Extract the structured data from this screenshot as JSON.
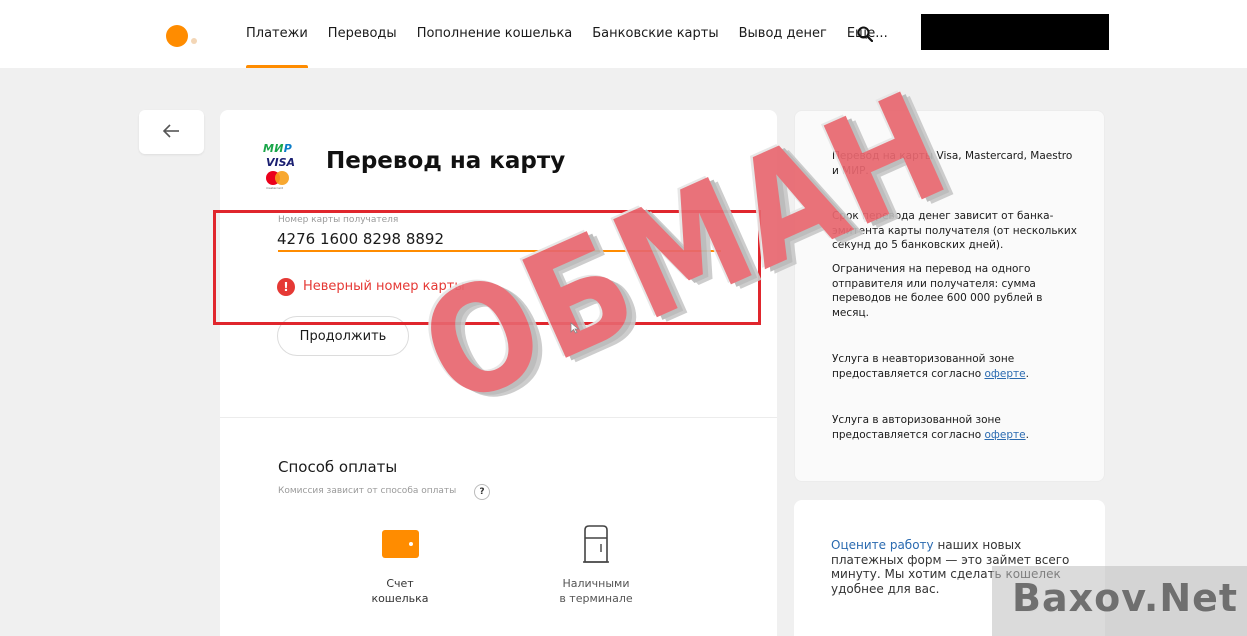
{
  "header": {
    "nav": [
      "Платежи",
      "Переводы",
      "Пополнение кошелька",
      "Банковские карты",
      "Вывод денег",
      "Еще..."
    ],
    "active_index": 0,
    "accent": "#ff8c00"
  },
  "card": {
    "logos": {
      "mir_a": "МИ",
      "mir_b": "Р",
      "visa": "VISA",
      "mastercard_caption": "mastercard"
    },
    "title": "Перевод на карту",
    "field_label": "Номер карты получателя",
    "card_number": "4276 1600 8298 8892",
    "error_icon": "!",
    "error": "Неверный номер карты",
    "continue_label": "Продолжить"
  },
  "payment": {
    "title": "Способ оплаты",
    "subtitle": "Комиссия зависит от способа оплаты",
    "help_icon": "?",
    "methods": [
      {
        "label": "Счет\nкошелька",
        "icon": "wallet-icon"
      },
      {
        "label": "Наличными\nв терминале",
        "icon": "terminal-icon"
      }
    ]
  },
  "info": {
    "p1": "Перевод на карты Visa, Mastercard, Maestro и МИР.",
    "p2": "Срок перевода денег зависит от банка-эмитента карты получателя (от нескольких секунд до 5 банковских дней).",
    "p3": "Ограничения на перевод на одного отправителя или получателя: сумма переводов не более 600 000 рублей в месяц.",
    "p4_prefix": "Услуга в неавторизованной зоне предоставляется согласно ",
    "p4_link": "оферте",
    "p4_suffix": ".",
    "p5_prefix": "Услуга в авторизованной зоне предоставляется согласно ",
    "p5_link": "оферте",
    "p5_suffix": "."
  },
  "feedback": {
    "link": "Оцените работу",
    "text": " наших новых платежных форм — это займет всего минуту. Мы хотим сделать кошелек удобнее для вас."
  },
  "overlay": {
    "stamp": "ОБМАН",
    "watermark": "Baxov.Net",
    "frame_color": "#e0262d"
  }
}
